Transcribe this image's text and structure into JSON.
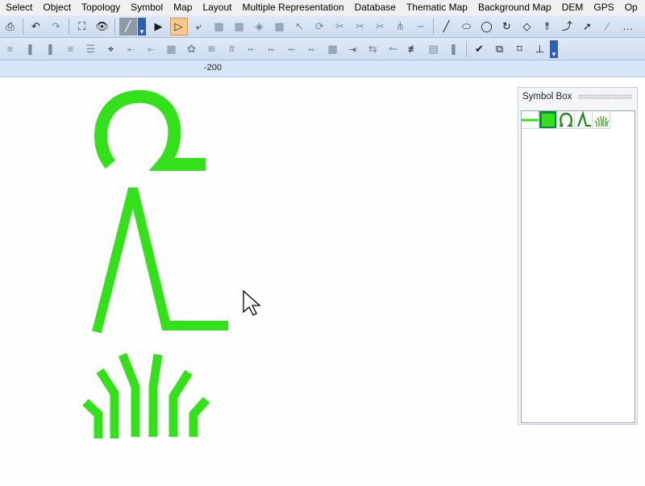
{
  "menubar": {
    "items": [
      "Select",
      "Object",
      "Topology",
      "Symbol",
      "Map",
      "Layout",
      "Multiple Representation",
      "Database",
      "Thematic Map",
      "Background Map",
      "DEM",
      "GPS",
      "Op"
    ]
  },
  "ruler": {
    "label": "-200"
  },
  "symbol_box": {
    "title": "Symbol Box",
    "symbols": [
      "line-symbol",
      "solid-fill-symbol",
      "omega-symbol",
      "lambda-symbol",
      "grass-symbol"
    ],
    "selected": "solid-fill-symbol"
  },
  "colors": {
    "symbol_green": "#33e11a",
    "toolbar_bg": "#d6e3f4",
    "active_tool": "#f7c98a"
  }
}
